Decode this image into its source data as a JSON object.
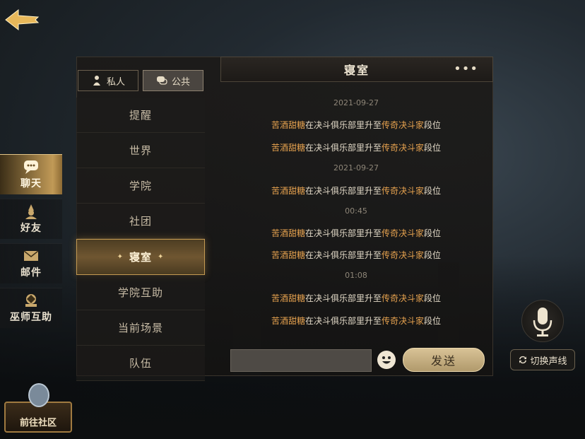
{
  "sidebar": {
    "items": [
      {
        "label": "聊天",
        "icon": "chat-bubble-icon",
        "active": true
      },
      {
        "label": "好友",
        "icon": "friend-icon",
        "active": false
      },
      {
        "label": "邮件",
        "icon": "mail-icon",
        "active": false
      },
      {
        "label": "巫师互助",
        "icon": "wizard-help-icon",
        "active": false
      }
    ],
    "community_label": "前往社区"
  },
  "tabs": [
    {
      "label": "私人",
      "icon": "private-icon",
      "active": false
    },
    {
      "label": "公共",
      "icon": "public-chat-icon",
      "active": true
    }
  ],
  "channels": [
    {
      "label": "提醒"
    },
    {
      "label": "世界"
    },
    {
      "label": "学院"
    },
    {
      "label": "社团"
    },
    {
      "label": "寝室",
      "active": true
    },
    {
      "label": "学院互助"
    },
    {
      "label": "当前场景"
    },
    {
      "label": "队伍"
    }
  ],
  "header": {
    "title": "寝室",
    "more": "•••"
  },
  "messages": [
    {
      "type": "time",
      "text": "2021-09-27"
    },
    {
      "type": "msg",
      "name": "苦酒甜糖",
      "mid": "在决斗俱乐部里升至",
      "rank": "传奇决斗家",
      "end": "段位"
    },
    {
      "type": "msg",
      "name": "苦酒甜糖",
      "mid": "在决斗俱乐部里升至",
      "rank": "传奇决斗家",
      "end": "段位"
    },
    {
      "type": "time",
      "text": "2021-09-27"
    },
    {
      "type": "msg",
      "name": "苦酒甜糖",
      "mid": "在决斗俱乐部里升至",
      "rank": "传奇决斗家",
      "end": "段位"
    },
    {
      "type": "time",
      "text": "00:45"
    },
    {
      "type": "msg",
      "name": "苦酒甜糖",
      "mid": "在决斗俱乐部里升至",
      "rank": "传奇决斗家",
      "end": "段位"
    },
    {
      "type": "msg",
      "name": "苦酒甜糖",
      "mid": "在决斗俱乐部里升至",
      "rank": "传奇决斗家",
      "end": "段位"
    },
    {
      "type": "time",
      "text": "01:08"
    },
    {
      "type": "msg",
      "name": "苦酒甜糖",
      "mid": "在决斗俱乐部里升至",
      "rank": "传奇决斗家",
      "end": "段位"
    },
    {
      "type": "msg",
      "name": "苦酒甜糖",
      "mid": "在决斗俱乐部里升至",
      "rank": "传奇决斗家",
      "end": "段位"
    }
  ],
  "composer": {
    "input_value": "",
    "send_label": "发送"
  },
  "voice": {
    "switch_label": "切换声线"
  },
  "colors": {
    "accent_gold": "#c19a57",
    "name_orange": "#e6a24f"
  }
}
